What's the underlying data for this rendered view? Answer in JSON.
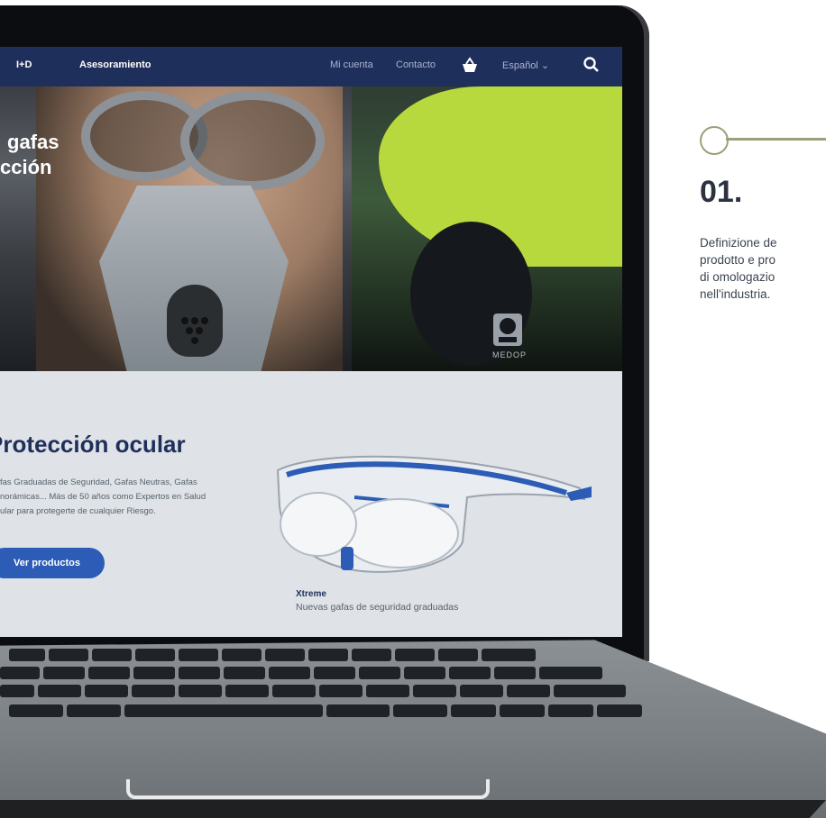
{
  "website": {
    "nav": {
      "items": [
        "I+D",
        "Asesoramiento"
      ],
      "right_items": [
        "Mi cuenta",
        "Contacto"
      ],
      "language": "Español",
      "cart_icon": "basket-icon",
      "search_icon": "search-icon"
    },
    "hero": {
      "title_line1": "gafas",
      "title_line2": "cción",
      "ear_logo_text": "MEDOP"
    },
    "section": {
      "title": "Protección ocular",
      "text_line1": "fas Graduadas de Seguridad, Gafas Neutras, Gafas",
      "text_line2": "norámicas... Más de 50 años como Expertos en Salud",
      "text_line3": "ular para protegerte de cualquier Riesgo.",
      "button": "Ver productos",
      "product_name": "Xtreme",
      "product_desc": "Nuevas gafas de seguridad graduadas"
    }
  },
  "panel": {
    "step_number": "01.",
    "lines": [
      "Definizione de",
      "prodotto e pro",
      "di omologazio",
      "nell'industria."
    ]
  },
  "colors": {
    "nav_bg": "#1f2f5b",
    "accent_button": "#2c5cb5",
    "deco": "#9aa07a"
  }
}
